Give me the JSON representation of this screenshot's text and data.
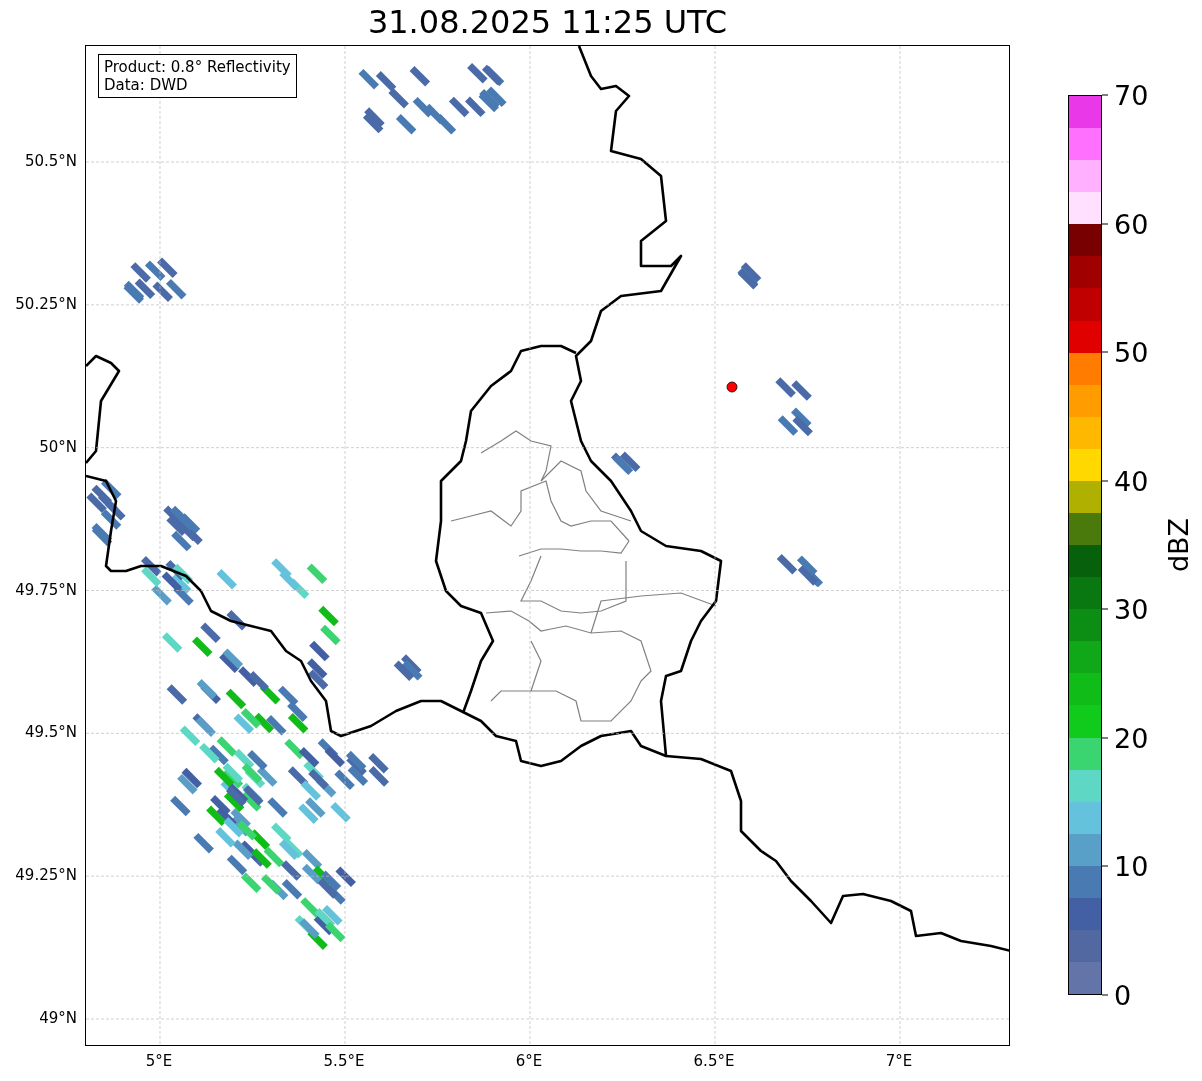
{
  "title": "31.08.2025 11:25 UTC",
  "info_box": {
    "lines": [
      "Product: 0.8° Reflectivity",
      "Data: DWD"
    ]
  },
  "map": {
    "xticks": [
      "5°E",
      "5.5°E",
      "6°E",
      "6.5°E",
      "7°E"
    ],
    "yticks": [
      "50.5°N",
      "50.25°N",
      "50°N",
      "49.75°N",
      "49.5°N",
      "49.25°N",
      "49°N"
    ]
  },
  "colorbar": {
    "label": "dBZ",
    "ticks": [
      "70",
      "60",
      "50",
      "40",
      "30",
      "20",
      "10",
      "0"
    ],
    "bands": [
      {
        "color": "#e838e8"
      },
      {
        "color": "#ff70ff"
      },
      {
        "color": "#ffb0ff"
      },
      {
        "color": "#ffe0ff"
      },
      {
        "color": "#780000"
      },
      {
        "color": "#a00000"
      },
      {
        "color": "#c00000"
      },
      {
        "color": "#e00000"
      },
      {
        "color": "#ff7c00"
      },
      {
        "color": "#ff9c00"
      },
      {
        "color": "#ffb800"
      },
      {
        "color": "#ffd800"
      },
      {
        "color": "#b0b000"
      },
      {
        "color": "#4a7a0c"
      },
      {
        "color": "#06600c"
      },
      {
        "color": "#0a7810"
      },
      {
        "color": "#0c8e14"
      },
      {
        "color": "#10a818"
      },
      {
        "color": "#10bc18"
      },
      {
        "color": "#10ca1c"
      },
      {
        "color": "#3ad470"
      },
      {
        "color": "#5ed8c4"
      },
      {
        "color": "#64c2dc"
      },
      {
        "color": "#58a0c8"
      },
      {
        "color": "#4a7ab2"
      },
      {
        "color": "#4360a5"
      },
      {
        "color": "#5268a0"
      },
      {
        "color": "#6374a8"
      }
    ]
  }
}
